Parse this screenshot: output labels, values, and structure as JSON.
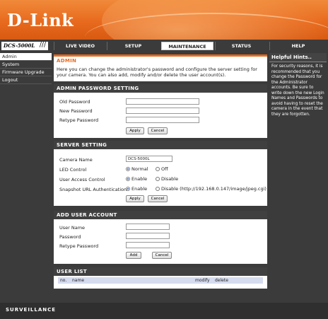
{
  "brand": {
    "logo": "D-Link",
    "model": "DCS-5000L",
    "slashes": "///",
    "footer": "SURVEILLANCE"
  },
  "tabs": [
    "LIVE VIDEO",
    "SETUP",
    "MAINTENANCE",
    "STATUS",
    "HELP"
  ],
  "sidebar": [
    "Admin",
    "System",
    "Firmware Upgrade",
    "Logout"
  ],
  "admin": {
    "title": "ADMIN",
    "description": "Here you can change the administrator's password and configure the server setting for your camera. You can also add, modify and/or delete the user account(s)."
  },
  "password": {
    "title": "ADMIN PASSWORD SETTING",
    "old_label": "Old Password",
    "new_label": "New Password",
    "retype_label": "Retype Password",
    "apply": "Apply",
    "cancel": "Cancel"
  },
  "server": {
    "title": "SERVER SETTING",
    "camera_label": "Camera Name",
    "camera_value": "DCS-5000L",
    "led_label": "LED Control",
    "led_on": "Normal",
    "led_off": "Off",
    "access_label": "User Access Control",
    "access_on": "Enable",
    "access_off": "Disable",
    "snapshot_label": "Snapshot URL Authentication",
    "snapshot_on": "Enable",
    "snapshot_off": "Disable (http://192.168.0.147/image/jpeg.cgi)",
    "apply": "Apply",
    "cancel": "Cancel"
  },
  "add_user": {
    "title": "ADD USER ACCOUNT",
    "user_label": "User Name",
    "pass_label": "Password",
    "retype_label": "Retype Password",
    "add": "Add",
    "cancel": "Cancel"
  },
  "user_list": {
    "title": "USER LIST",
    "columns": [
      "no.",
      "name",
      "modify",
      "delete"
    ]
  },
  "help": {
    "title": "Helpful Hints..",
    "text": "For security reasons, it is recommended that you change the Password for the Administrator accounts. Be sure to write down the new Login Names and Passwords to avoid having to reset the camera in the event that they are forgotten."
  },
  "colors": {
    "accent": "#e86a1e",
    "dark": "#3b3b3b"
  }
}
